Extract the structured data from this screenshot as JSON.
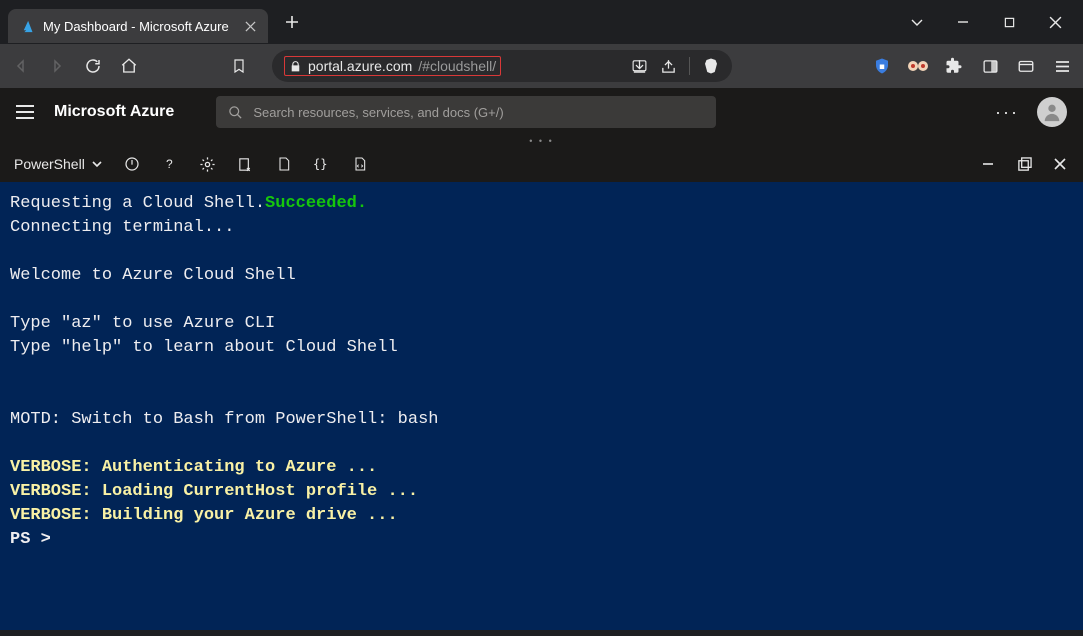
{
  "browser": {
    "tab_title": "My Dashboard - Microsoft Azure",
    "url_host": "portal.azure.com",
    "url_path": "/#cloudshell/"
  },
  "azure": {
    "brand": "Microsoft Azure",
    "search_placeholder": "Search resources, services, and docs (G+/)"
  },
  "cloudshell": {
    "shell_mode": "PowerShell"
  },
  "terminal": {
    "l1a": "Requesting a Cloud Shell.",
    "l1b": "Succeeded.",
    "l2": "Connecting terminal...",
    "l3": "Welcome to Azure Cloud Shell",
    "l4": "Type \"az\" to use Azure CLI",
    "l5": "Type \"help\" to learn about Cloud Shell",
    "l6": "MOTD: Switch to Bash from PowerShell: bash",
    "v1": "VERBOSE: Authenticating to Azure ...",
    "v2": "VERBOSE: Loading CurrentHost profile ...",
    "v3": "VERBOSE: Building your Azure drive ...",
    "prompt": "PS > "
  }
}
